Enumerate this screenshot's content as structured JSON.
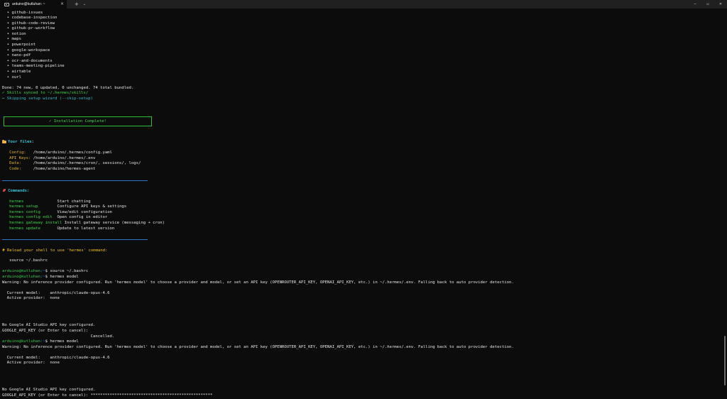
{
  "window": {
    "tab_title": "arduino@kutluhan: ~",
    "tab_close": "×",
    "new_tab": "+",
    "dropdown": "⌄",
    "minimize": "─",
    "maximize": "▫",
    "close": "✕"
  },
  "skills_list": [
    "  • github-issues",
    "  • codebase-inspection",
    "  • github-code-review",
    "  • github-pr-workflow",
    "  • notion",
    "  • maps",
    "  • powerpoint",
    "  • google-workspace",
    "  • nano-pdf",
    "  • ocr-and-documents",
    "  • teams-meeting-pipeline",
    "  • airtable",
    "  • xurl"
  ],
  "sync": {
    "done": "Done: 74 new, 0 updated, 0 unchanged. 74 total bundled.",
    "synced": "✓ Skills synced to ~/.hermes/skills/",
    "skipping": "→ Skipping setup wizard (--skip-setup)"
  },
  "install_box": "✓ Installation Complete!",
  "files": {
    "heading": "Your files:",
    "rows": [
      {
        "key": "   Config:   ",
        "val": "/home/arduino/.hermes/config.yaml"
      },
      {
        "key": "   API Keys: ",
        "val": "/home/arduino/.hermes/.env"
      },
      {
        "key": "   Data:     ",
        "val": "/home/arduino/.hermes/cron/, sessions/, logs/"
      },
      {
        "key": "   Code:     ",
        "val": "/home/arduino/hermes-agent"
      }
    ]
  },
  "commands": {
    "heading": "Commands:",
    "rows": [
      {
        "cmd": "   hermes              ",
        "desc": "Start chatting"
      },
      {
        "cmd": "   hermes setup        ",
        "desc": "Configure API keys & settings"
      },
      {
        "cmd": "   hermes config       ",
        "desc": "View/edit configuration"
      },
      {
        "cmd": "   hermes config edit  ",
        "desc": "Open config in editor"
      },
      {
        "cmd": "   hermes gateway install",
        "desc": " Install gateway service (messaging + cron)"
      },
      {
        "cmd": "   hermes update       ",
        "desc": "Update to latest version"
      }
    ]
  },
  "reload": {
    "message": "Reload your shell to use 'hermes' command:",
    "source_cmd": "   source ~/.bashrc"
  },
  "session": {
    "prompt_user": "arduino@kutluhan",
    "prompt_path": ":~",
    "prompt_sign": "$ ",
    "cmd1": "source ~/.bashrc",
    "cmd2": "hermes model",
    "warning": "Warning: No inference provider configured. Run 'hermes model' to choose a provider and model, or set an API key (OPENROUTER_API_KEY, OPENAI_API_KEY, etc.) in ~/.hermes/.env. Falling back to auto provider detection.",
    "current_model": "  Current model:    anthropic/claude-opus-4.6",
    "active_provider": "  Active provider:  none",
    "no_google": "No Google AI Studio API key configured.",
    "google_prompt": "GOOGLE_API_KEY (or Enter to cancel):",
    "cancelled": "                                     Cancelled.",
    "google_prompt_filled": "GOOGLE_API_KEY (or Enter to cancel): ***************************************************"
  }
}
